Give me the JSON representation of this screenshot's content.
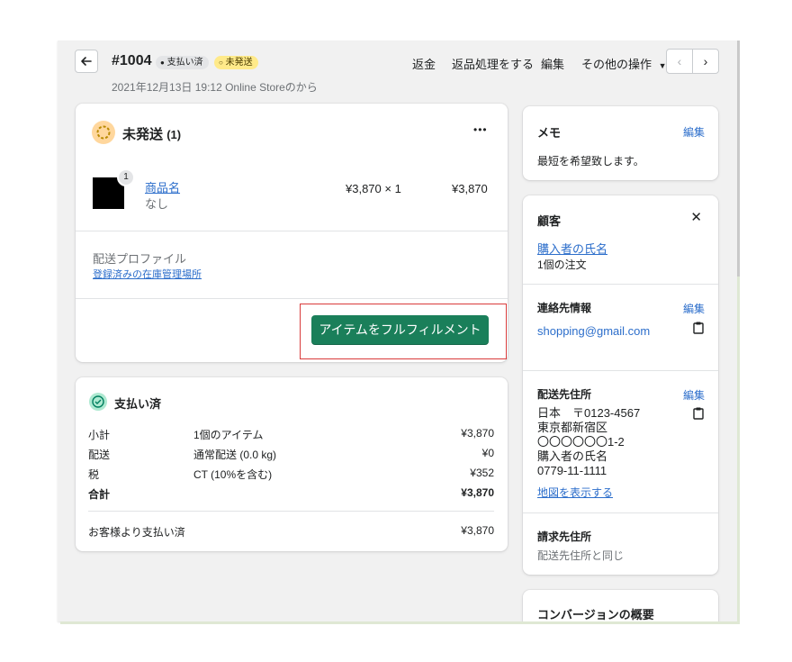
{
  "header": {
    "order_number": "#1004",
    "payment_badge": "支払い済",
    "fulfillment_badge": "未発送",
    "subtitle": "2021年12月13日 19:12 Online Storeのから",
    "actions": {
      "refund": "返金",
      "return": "返品処理をする",
      "edit": "編集",
      "more": "その他の操作"
    }
  },
  "fulfillment": {
    "title": "未発送",
    "count": "(1)",
    "more_label": "•••",
    "item": {
      "quantity_badge": "1",
      "name": "商品名",
      "variant": "なし",
      "unit_price": "¥3,870 × 1",
      "total": "¥3,870"
    },
    "shipping_profile_label": "配送プロファイル",
    "location_link": "登録済みの在庫管理場所",
    "fulfill_button": "アイテムをフルフィルメント"
  },
  "payment": {
    "title": "支払い済",
    "rows": [
      {
        "label": "小計",
        "desc": "1個のアイテム",
        "amount": "¥3,870"
      },
      {
        "label": "配送",
        "desc": "通常配送 (0.0 kg)",
        "amount": "¥0"
      },
      {
        "label": "税",
        "desc": "CT (10%を含む)",
        "amount": "¥352"
      },
      {
        "label": "合計",
        "desc": "",
        "amount": "¥3,870"
      }
    ],
    "paid_by_customer": {
      "label": "お客様より支払い済",
      "amount": "¥3,870"
    }
  },
  "notes": {
    "title": "メモ",
    "edit": "編集",
    "text": "最短を希望致します。"
  },
  "customer": {
    "title": "顧客",
    "name": "購入者の氏名",
    "orders": "1個の注文",
    "contact_title": "連絡先情報",
    "contact_edit": "編集",
    "email": "shopping@gmail.com",
    "shipping_title": "配送先住所",
    "shipping_edit": "編集",
    "address_lines": [
      "日本　〒0123-4567",
      "東京都新宿区",
      "〇〇〇〇〇〇1-2",
      "購入者の氏名",
      "0779-11-1111"
    ],
    "map_link": "地図を表示する",
    "billing_title": "請求先住所",
    "billing_text": "配送先住所と同じ"
  },
  "conversion": {
    "title": "コンバージョンの概要"
  },
  "colors": {
    "primary": "#1a7f5a",
    "link": "#2c6ecb",
    "highlight": "#d93b3b",
    "unfulfilled_badge": "#ffea8a"
  }
}
